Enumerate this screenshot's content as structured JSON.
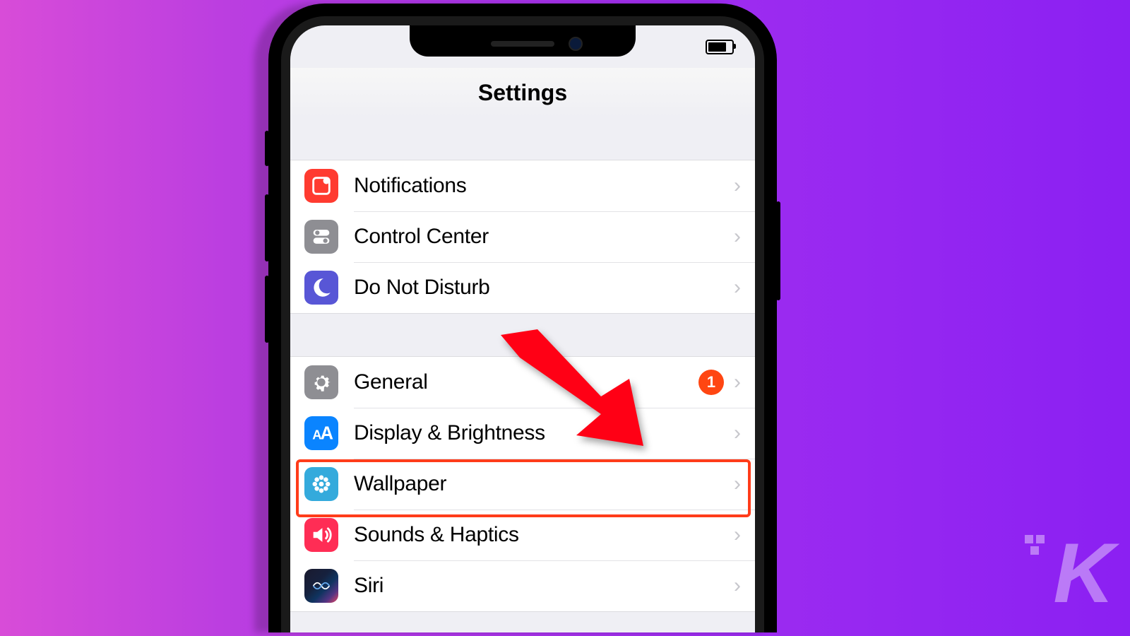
{
  "header": {
    "title": "Settings"
  },
  "statusbar": {
    "battery_pct": 70
  },
  "groups": [
    {
      "rows": [
        {
          "id": "notifications",
          "label": "Notifications",
          "icon": "notifications-icon"
        },
        {
          "id": "control-center",
          "label": "Control Center",
          "icon": "control-center-icon"
        },
        {
          "id": "do-not-disturb",
          "label": "Do Not Disturb",
          "icon": "moon-icon"
        }
      ]
    },
    {
      "rows": [
        {
          "id": "general",
          "label": "General",
          "icon": "gear-icon",
          "badge": "1"
        },
        {
          "id": "display",
          "label": "Display & Brightness",
          "icon": "text-size-icon"
        },
        {
          "id": "wallpaper",
          "label": "Wallpaper",
          "icon": "flower-icon",
          "highlighted": true
        },
        {
          "id": "sounds",
          "label": "Sounds & Haptics",
          "icon": "speaker-icon"
        },
        {
          "id": "siri",
          "label": "Siri",
          "icon": "siri-icon"
        }
      ]
    }
  ],
  "annotations": {
    "arrow_target": "wallpaper",
    "highlight_target": "wallpaper",
    "highlight_color": "#ff3c1a"
  },
  "watermark": {
    "text": "K"
  }
}
